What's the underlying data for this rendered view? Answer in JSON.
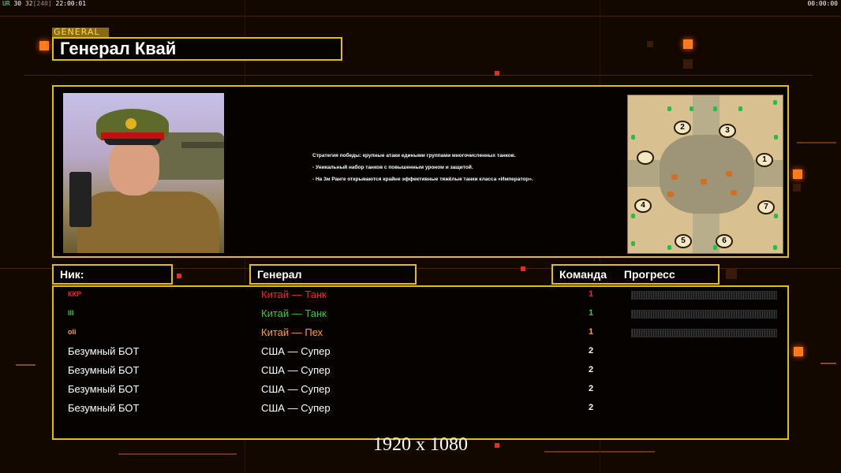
{
  "hud": {
    "left_prefix": "UR",
    "left_fps": "30",
    "left_value": "32",
    "left_bracket": "[240]",
    "left_time": "22:00:01",
    "right_time": "00:00:00"
  },
  "header": {
    "tag": "GENERAL",
    "title": "Генерал Квай"
  },
  "general_info": {
    "description": [
      "Стратегия победы: крупные атаки едиными группами многочисленных танков.",
      "- Уникальный набор танков с повышенным уроном и защитой.",
      "- На 3м Ранге открываются крайне эффективные тяжёлые танки класса «Император»."
    ]
  },
  "minimap": {
    "bases": [
      "2",
      "3",
      "1",
      "4",
      "7",
      "5",
      "6"
    ]
  },
  "columns": {
    "nick": "Ник:",
    "general": "Генерал",
    "team": "Команда",
    "progress": "Прогресс"
  },
  "players": [
    {
      "nick": "ККР",
      "general": "Китай — Танк",
      "team": "1",
      "color": "#ff2020",
      "progress": 0.0,
      "show_progress": true
    },
    {
      "nick": "lll",
      "general": "Китай — Танк",
      "team": "1",
      "color": "#30d030",
      "progress": 0.0,
      "show_progress": true
    },
    {
      "nick": "oli",
      "general": "Китай — Пех",
      "team": "1",
      "color": "#ffa030",
      "progress": 0.0,
      "show_progress": true
    },
    {
      "nick": "Безумный БОТ",
      "general": "США — Супер",
      "team": "2",
      "color": "#ffffff",
      "show_progress": false
    },
    {
      "nick": "Безумный БОТ",
      "general": "США — Супер",
      "team": "2",
      "color": "#ffffff",
      "show_progress": false
    },
    {
      "nick": "Безумный БОТ",
      "general": "США — Супер",
      "team": "2",
      "color": "#ffffff",
      "show_progress": false
    },
    {
      "nick": "Безумный БОТ",
      "general": "США — Супер",
      "team": "2",
      "color": "#ffffff",
      "show_progress": false
    }
  ],
  "resolution_label": "1920 x 1080",
  "colors": {
    "accent_border": "#e0c000",
    "background": "#120800",
    "glow": "#ff7a1a"
  }
}
